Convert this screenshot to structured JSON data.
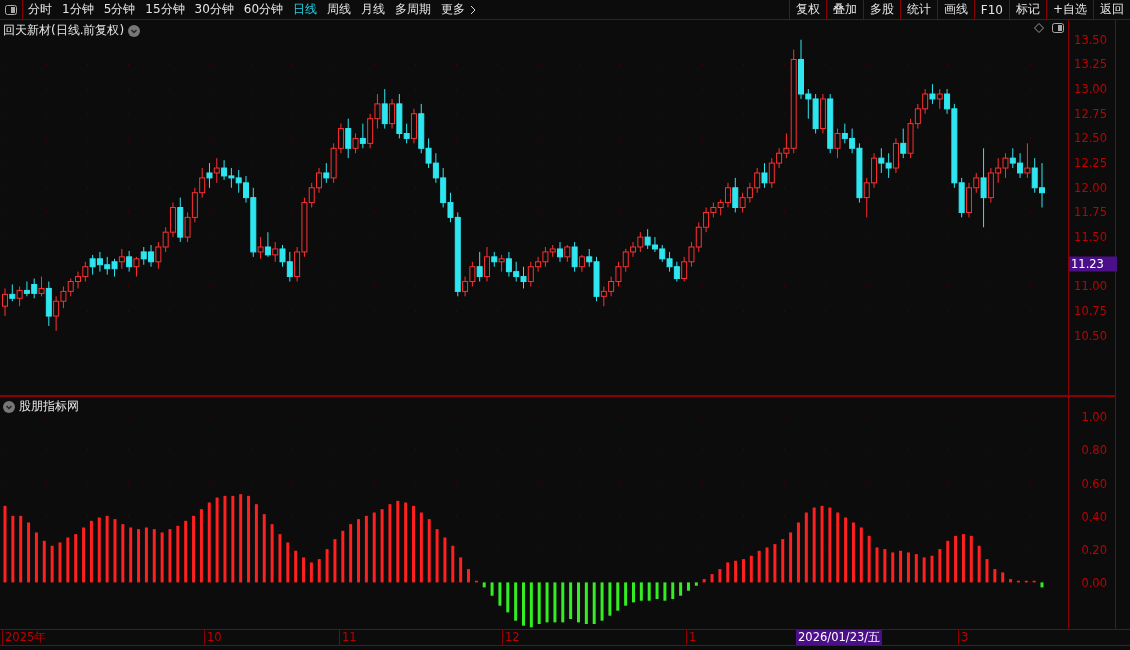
{
  "toolbar": {
    "periods": [
      {
        "label": "分时",
        "selected": false
      },
      {
        "label": "1分钟",
        "selected": false
      },
      {
        "label": "5分钟",
        "selected": false
      },
      {
        "label": "15分钟",
        "selected": false
      },
      {
        "label": "30分钟",
        "selected": false
      },
      {
        "label": "60分钟",
        "selected": false
      },
      {
        "label": "日线",
        "selected": true
      },
      {
        "label": "周线",
        "selected": false
      },
      {
        "label": "月线",
        "selected": false
      },
      {
        "label": "多周期",
        "selected": false
      }
    ],
    "more": "更多",
    "buttons": [
      "复权",
      "叠加",
      "多股",
      "统计",
      "画线",
      "F10",
      "标记",
      "+自选",
      "返回"
    ]
  },
  "main_pane": {
    "title": "回天新材(日线.前复权)",
    "current_price": "11.23",
    "chart_data": {
      "type": "candlestick",
      "grid": true,
      "ylim": [
        9.89,
        13.7
      ],
      "yticks": [
        {
          "value": 13.5,
          "label": "13.50"
        },
        {
          "value": 13.25,
          "label": "13.25"
        },
        {
          "value": 13,
          "label": "13.00"
        },
        {
          "value": 12.75,
          "label": "12.75"
        },
        {
          "value": 12.5,
          "label": "12.50"
        },
        {
          "value": 12.25,
          "label": "12.25"
        },
        {
          "value": 12,
          "label": "12.00"
        },
        {
          "value": 11.75,
          "label": "11.75"
        },
        {
          "value": 11.5,
          "label": "11.50"
        },
        {
          "value": 11,
          "label": "11.00"
        },
        {
          "value": 10.75,
          "label": "10.75"
        },
        {
          "value": 10.5,
          "label": "10.50"
        }
      ],
      "ohlc": [
        [
          10.8,
          10.98,
          10.7,
          10.92
        ],
        [
          10.92,
          11.02,
          10.85,
          10.88
        ],
        [
          10.88,
          11.0,
          10.8,
          10.96
        ],
        [
          10.96,
          11.05,
          10.9,
          10.93
        ],
        [
          11.02,
          11.08,
          10.88,
          10.93
        ],
        [
          10.93,
          11.1,
          10.9,
          10.98
        ],
        [
          10.98,
          11.05,
          10.6,
          10.7
        ],
        [
          10.7,
          10.9,
          10.55,
          10.85
        ],
        [
          10.85,
          11.0,
          10.78,
          10.95
        ],
        [
          10.95,
          11.08,
          10.9,
          11.05
        ],
        [
          11.05,
          11.15,
          10.98,
          11.1
        ],
        [
          11.1,
          11.25,
          11.05,
          11.2
        ],
        [
          11.28,
          11.32,
          11.12,
          11.2
        ],
        [
          11.28,
          11.35,
          11.15,
          11.22
        ],
        [
          11.22,
          11.3,
          11.12,
          11.18
        ],
        [
          11.25,
          11.28,
          11.1,
          11.18
        ],
        [
          11.25,
          11.38,
          11.18,
          11.3
        ],
        [
          11.3,
          11.36,
          11.15,
          11.2
        ],
        [
          11.2,
          11.3,
          11.1,
          11.28
        ],
        [
          11.35,
          11.4,
          11.22,
          11.28
        ],
        [
          11.35,
          11.42,
          11.2,
          11.25
        ],
        [
          11.25,
          11.45,
          11.18,
          11.4
        ],
        [
          11.4,
          11.6,
          11.35,
          11.55
        ],
        [
          11.55,
          11.85,
          11.5,
          11.8
        ],
        [
          11.8,
          11.9,
          11.45,
          11.5
        ],
        [
          11.5,
          11.75,
          11.45,
          11.7
        ],
        [
          11.7,
          12.0,
          11.65,
          11.95
        ],
        [
          11.95,
          12.2,
          11.9,
          12.1
        ],
        [
          12.15,
          12.25,
          12.0,
          12.1
        ],
        [
          12.15,
          12.3,
          12.05,
          12.2
        ],
        [
          12.2,
          12.28,
          12.08,
          12.12
        ],
        [
          12.12,
          12.2,
          12.0,
          12.1
        ],
        [
          12.1,
          12.18,
          11.95,
          12.05
        ],
        [
          12.05,
          12.12,
          11.85,
          11.9
        ],
        [
          11.9,
          12.0,
          11.3,
          11.35
        ],
        [
          11.35,
          11.5,
          11.28,
          11.4
        ],
        [
          11.4,
          11.55,
          11.3,
          11.32
        ],
        [
          11.32,
          11.45,
          11.25,
          11.38
        ],
        [
          11.38,
          11.42,
          11.2,
          11.25
        ],
        [
          11.25,
          11.35,
          11.05,
          11.1
        ],
        [
          11.1,
          11.4,
          11.05,
          11.35
        ],
        [
          11.35,
          11.9,
          11.3,
          11.85
        ],
        [
          11.85,
          12.05,
          11.8,
          12.0
        ],
        [
          12.0,
          12.2,
          11.95,
          12.15
        ],
        [
          12.15,
          12.25,
          12.05,
          12.1
        ],
        [
          12.1,
          12.45,
          12.05,
          12.4
        ],
        [
          12.4,
          12.65,
          12.35,
          12.6
        ],
        [
          12.6,
          12.7,
          12.3,
          12.4
        ],
        [
          12.4,
          12.55,
          12.35,
          12.5
        ],
        [
          12.5,
          12.65,
          12.4,
          12.45
        ],
        [
          12.45,
          12.75,
          12.4,
          12.7
        ],
        [
          12.7,
          12.95,
          12.6,
          12.85
        ],
        [
          12.85,
          13.0,
          12.6,
          12.65
        ],
        [
          12.65,
          12.9,
          12.6,
          12.85
        ],
        [
          12.85,
          12.95,
          12.5,
          12.55
        ],
        [
          12.55,
          12.65,
          12.45,
          12.5
        ],
        [
          12.5,
          12.8,
          12.45,
          12.75
        ],
        [
          12.75,
          12.85,
          12.35,
          12.4
        ],
        [
          12.4,
          12.5,
          12.2,
          12.25
        ],
        [
          12.25,
          12.35,
          12.05,
          12.1
        ],
        [
          12.1,
          12.2,
          11.8,
          11.85
        ],
        [
          11.85,
          11.95,
          11.65,
          11.7
        ],
        [
          11.7,
          11.75,
          10.9,
          10.95
        ],
        [
          10.95,
          11.1,
          10.9,
          11.05
        ],
        [
          11.05,
          11.25,
          11.0,
          11.2
        ],
        [
          11.2,
          11.35,
          11.05,
          11.1
        ],
        [
          11.1,
          11.4,
          11.05,
          11.3
        ],
        [
          11.3,
          11.35,
          11.2,
          11.25
        ],
        [
          11.25,
          11.32,
          11.15,
          11.28
        ],
        [
          11.28,
          11.35,
          11.1,
          11.15
        ],
        [
          11.15,
          11.25,
          11.05,
          11.1
        ],
        [
          11.1,
          11.2,
          10.98,
          11.05
        ],
        [
          11.05,
          11.25,
          11.0,
          11.2
        ],
        [
          11.2,
          11.3,
          11.15,
          11.25
        ],
        [
          11.25,
          11.4,
          11.2,
          11.35
        ],
        [
          11.35,
          11.42,
          11.3,
          11.38
        ],
        [
          11.38,
          11.45,
          11.25,
          11.3
        ],
        [
          11.3,
          11.42,
          11.25,
          11.4
        ],
        [
          11.4,
          11.45,
          11.15,
          11.2
        ],
        [
          11.2,
          11.32,
          11.15,
          11.3
        ],
        [
          11.3,
          11.38,
          11.2,
          11.25
        ],
        [
          11.25,
          11.3,
          10.85,
          10.9
        ],
        [
          10.9,
          11.0,
          10.8,
          10.95
        ],
        [
          10.95,
          11.1,
          10.9,
          11.05
        ],
        [
          11.05,
          11.25,
          11.0,
          11.2
        ],
        [
          11.2,
          11.38,
          11.15,
          11.35
        ],
        [
          11.35,
          11.45,
          11.3,
          11.4
        ],
        [
          11.4,
          11.55,
          11.35,
          11.5
        ],
        [
          11.5,
          11.58,
          11.38,
          11.42
        ],
        [
          11.42,
          11.5,
          11.35,
          11.38
        ],
        [
          11.38,
          11.42,
          11.25,
          11.28
        ],
        [
          11.28,
          11.35,
          11.15,
          11.2
        ],
        [
          11.2,
          11.25,
          11.05,
          11.08
        ],
        [
          11.08,
          11.3,
          11.05,
          11.25
        ],
        [
          11.25,
          11.45,
          11.2,
          11.4
        ],
        [
          11.4,
          11.65,
          11.35,
          11.6
        ],
        [
          11.6,
          11.8,
          11.55,
          11.75
        ],
        [
          11.75,
          11.85,
          11.7,
          11.8
        ],
        [
          11.8,
          11.88,
          11.72,
          11.85
        ],
        [
          11.85,
          12.05,
          11.8,
          12.0
        ],
        [
          12.0,
          12.1,
          11.75,
          11.8
        ],
        [
          11.8,
          11.95,
          11.75,
          11.9
        ],
        [
          11.9,
          12.05,
          11.85,
          12.0
        ],
        [
          12.0,
          12.2,
          11.95,
          12.15
        ],
        [
          12.15,
          12.25,
          12.0,
          12.05
        ],
        [
          12.05,
          12.3,
          12.0,
          12.25
        ],
        [
          12.25,
          12.4,
          12.2,
          12.35
        ],
        [
          12.35,
          12.55,
          12.3,
          12.4
        ],
        [
          12.4,
          13.4,
          12.35,
          13.3
        ],
        [
          13.3,
          13.5,
          12.9,
          12.95
        ],
        [
          12.95,
          13.0,
          12.7,
          12.9
        ],
        [
          12.9,
          12.95,
          12.55,
          12.6
        ],
        [
          12.6,
          12.95,
          12.55,
          12.9
        ],
        [
          12.9,
          12.95,
          12.35,
          12.4
        ],
        [
          12.4,
          12.6,
          12.3,
          12.55
        ],
        [
          12.55,
          12.65,
          12.45,
          12.5
        ],
        [
          12.5,
          12.6,
          12.35,
          12.4
        ],
        [
          12.4,
          12.45,
          11.85,
          11.9
        ],
        [
          11.9,
          12.1,
          11.7,
          12.05
        ],
        [
          12.05,
          12.35,
          12.0,
          12.3
        ],
        [
          12.3,
          12.4,
          12.15,
          12.25
        ],
        [
          12.25,
          12.35,
          12.1,
          12.2
        ],
        [
          12.2,
          12.5,
          12.15,
          12.45
        ],
        [
          12.45,
          12.6,
          12.3,
          12.35
        ],
        [
          12.35,
          12.7,
          12.3,
          12.65
        ],
        [
          12.65,
          12.85,
          12.6,
          12.8
        ],
        [
          12.8,
          13.0,
          12.75,
          12.95
        ],
        [
          12.95,
          13.05,
          12.85,
          12.9
        ],
        [
          12.9,
          13.0,
          12.8,
          12.95
        ],
        [
          12.95,
          13.0,
          12.75,
          12.8
        ],
        [
          12.8,
          12.85,
          12.0,
          12.05
        ],
        [
          12.05,
          12.1,
          11.7,
          11.75
        ],
        [
          11.75,
          12.05,
          11.7,
          12.0
        ],
        [
          12.0,
          12.15,
          11.95,
          12.1
        ],
        [
          12.1,
          12.4,
          11.6,
          11.9
        ],
        [
          11.9,
          12.2,
          11.85,
          12.15
        ],
        [
          12.15,
          12.3,
          12.05,
          12.2
        ],
        [
          12.2,
          12.35,
          12.1,
          12.3
        ],
        [
          12.3,
          12.4,
          12.2,
          12.25
        ],
        [
          12.25,
          12.35,
          12.1,
          12.15
        ],
        [
          12.15,
          12.45,
          12.1,
          12.2
        ],
        [
          12.2,
          12.3,
          11.95,
          12.0
        ],
        [
          12.0,
          12.25,
          11.8,
          11.95
        ]
      ]
    }
  },
  "indicator_pane": {
    "title": "股朋指标网",
    "chart_data": {
      "type": "bar",
      "grid": true,
      "ylim": [
        -0.28,
        1.12
      ],
      "yticks": [
        {
          "value": 0,
          "label": "0.00"
        },
        {
          "value": 0.2,
          "label": "0.20"
        },
        {
          "value": 0.4,
          "label": "0.40"
        },
        {
          "value": 0.6,
          "label": "0.60"
        },
        {
          "value": 0.8,
          "label": "0.80"
        },
        {
          "value": 1,
          "label": "1.00"
        }
      ],
      "values": [
        0.46,
        0.4,
        0.4,
        0.36,
        0.3,
        0.25,
        0.22,
        0.24,
        0.27,
        0.29,
        0.33,
        0.37,
        0.39,
        0.4,
        0.38,
        0.35,
        0.33,
        0.32,
        0.33,
        0.32,
        0.3,
        0.32,
        0.34,
        0.37,
        0.4,
        0.44,
        0.48,
        0.51,
        0.52,
        0.52,
        0.53,
        0.52,
        0.47,
        0.41,
        0.35,
        0.29,
        0.24,
        0.19,
        0.15,
        0.12,
        0.14,
        0.2,
        0.26,
        0.31,
        0.35,
        0.38,
        0.4,
        0.42,
        0.44,
        0.47,
        0.49,
        0.48,
        0.46,
        0.42,
        0.38,
        0.32,
        0.27,
        0.22,
        0.15,
        0.08,
        0.01,
        -0.03,
        -0.08,
        -0.14,
        -0.18,
        -0.23,
        -0.26,
        -0.27,
        -0.25,
        -0.24,
        -0.24,
        -0.24,
        -0.22,
        -0.24,
        -0.25,
        -0.25,
        -0.23,
        -0.2,
        -0.17,
        -0.14,
        -0.12,
        -0.11,
        -0.11,
        -0.1,
        -0.11,
        -0.1,
        -0.08,
        -0.05,
        -0.02,
        0.02,
        0.05,
        0.08,
        0.12,
        0.13,
        0.14,
        0.16,
        0.19,
        0.21,
        0.23,
        0.26,
        0.3,
        0.36,
        0.42,
        0.45,
        0.46,
        0.45,
        0.42,
        0.39,
        0.36,
        0.33,
        0.28,
        0.21,
        0.2,
        0.18,
        0.19,
        0.18,
        0.17,
        0.15,
        0.16,
        0.2,
        0.25,
        0.28,
        0.29,
        0.28,
        0.22,
        0.14,
        0.08,
        0.06,
        0.02,
        0.01,
        0.01,
        0.01,
        -0.03
      ]
    }
  },
  "time_axis": {
    "labels": [
      "2025年",
      "10",
      "11",
      "12",
      "1",
      "3"
    ],
    "cursor_date": "2026/01/23/五"
  }
}
